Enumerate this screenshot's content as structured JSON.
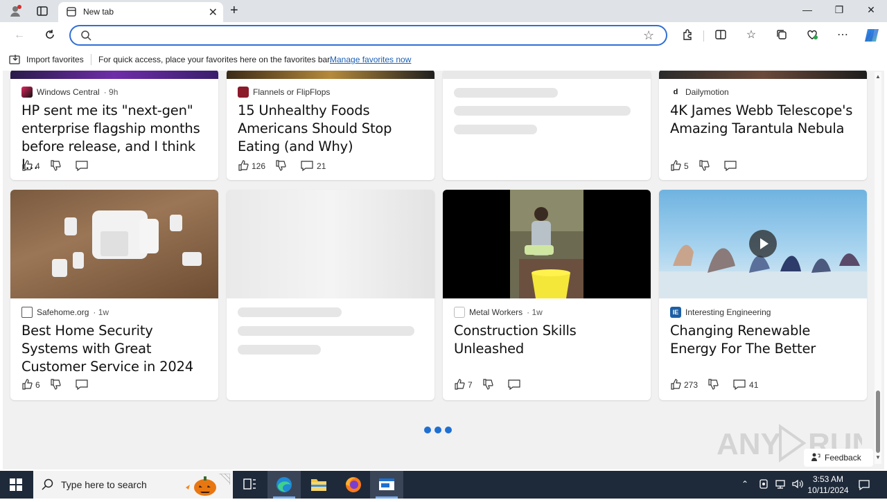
{
  "browser": {
    "tab_title": "New tab",
    "search_placeholder": "",
    "favorites_bar": {
      "import_label": "Import favorites",
      "hint": "For quick access, place your favorites here on the favorites bar.",
      "manage_link": "Manage favorites now"
    }
  },
  "feed": {
    "row1": [
      {
        "source": "Windows Central",
        "age": "· 9h",
        "headline": "HP sent me its \"next-gen\" enterprise flagship months before release, and I think I...",
        "likes": "4",
        "comments": ""
      },
      {
        "source": "Flannels or FlipFlops",
        "age": "",
        "headline": "15 Unhealthy Foods Americans Should Stop Eating (and Why)",
        "likes": "126",
        "comments": "21"
      },
      {
        "source": "",
        "age": "",
        "headline": "",
        "likes": "",
        "comments": ""
      },
      {
        "source": "Dailymotion",
        "age": "",
        "headline": "4K James Webb Telescope's Amazing Tarantula Nebula",
        "likes": "5",
        "comments": ""
      }
    ],
    "row2": [
      {
        "source": "Safehome.org",
        "age": "· 1w",
        "headline": "Best Home Security Systems with Great Customer Service in 2024",
        "likes": "6",
        "comments": ""
      },
      {
        "source": "",
        "age": "",
        "headline": "",
        "likes": "",
        "comments": ""
      },
      {
        "source": "Metal Workers",
        "age": "· 1w",
        "headline": "Construction Skills Unleashed",
        "likes": "7",
        "comments": ""
      },
      {
        "source": "Interesting Engineering",
        "age": "",
        "headline": "Changing Renewable Energy For The Better",
        "likes": "273",
        "comments": "41"
      }
    ],
    "feedback_label": "Feedback"
  },
  "taskbar": {
    "search_placeholder": "Type here to search",
    "time": "3:53 AM",
    "date": "10/11/2024"
  },
  "colors": {
    "accent": "#2f6ed6",
    "loading_dots": "#1f6fd1"
  }
}
